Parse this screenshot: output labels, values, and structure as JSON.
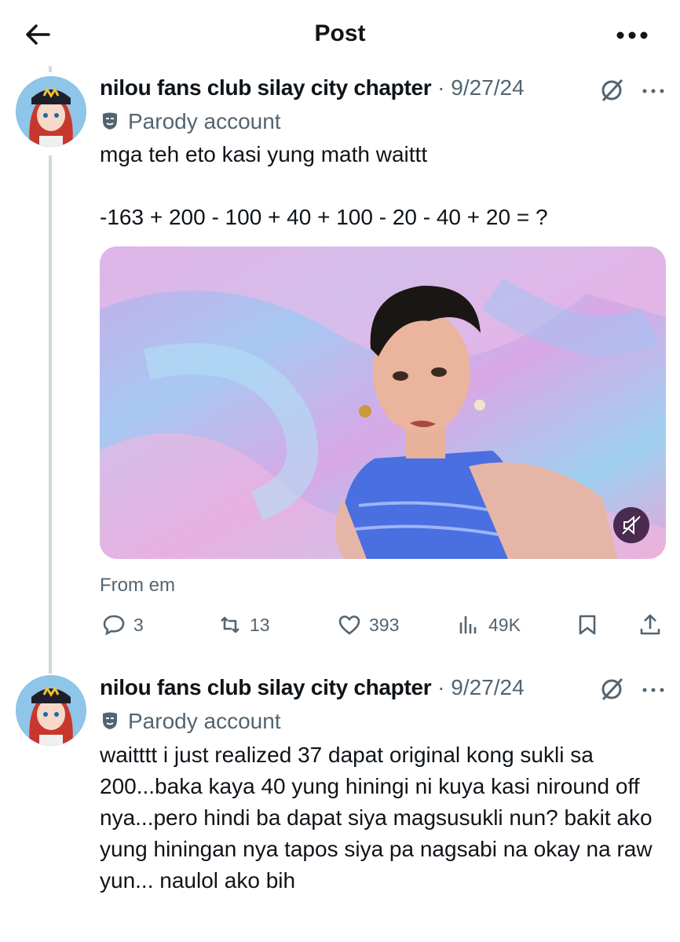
{
  "header": {
    "title": "Post"
  },
  "posts": [
    {
      "author": "nilou fans club silay city chapter",
      "separator": "·",
      "date": "9/27/24",
      "badge": "Parody account",
      "text": "mga teh eto kasi yung math waittt\n\n-163 + 200 - 100 + 40 + 100 - 20 - 40 + 20 = ?",
      "media_caption": "From em",
      "stats": {
        "replies": "3",
        "reposts": "13",
        "likes": "393",
        "views": "49K"
      }
    },
    {
      "author": "nilou fans club silay city chapter",
      "separator": "·",
      "date": "9/27/24",
      "badge": "Parody account",
      "text": "waitttt i just realized 37 dapat original kong sukli sa 200...baka kaya 40 yung hiningi ni kuya kasi niround off nya...pero hindi ba dapat siya magsusukli nun? bakit ako yung hiningan nya tapos siya pa nagsabi na okay na raw yun... naulol ako bih"
    }
  ],
  "icons": [
    "back-arrow-icon",
    "more-icon",
    "grok-icon",
    "parody-mask-icon",
    "reply-icon",
    "repost-icon",
    "like-icon",
    "views-icon",
    "bookmark-icon",
    "share-icon",
    "mute-icon"
  ],
  "colors": {
    "text": "#0f1419",
    "muted": "#536471",
    "thread_line": "#cfd9de"
  }
}
